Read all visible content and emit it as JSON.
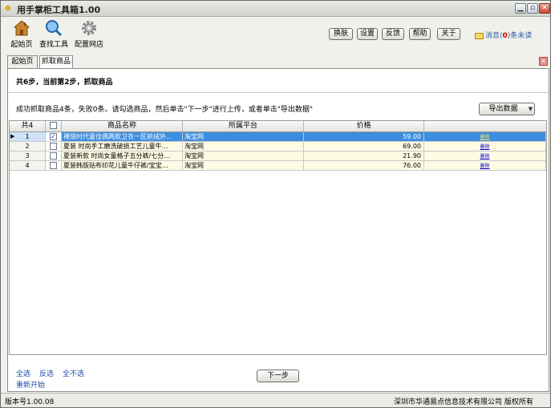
{
  "window": {
    "title": "用手掌柜工具箱1.00",
    "min": "▁",
    "max": "▫",
    "close": "✕"
  },
  "toolbar": {
    "tools": [
      {
        "label": "起始页",
        "icon": "home-icon"
      },
      {
        "label": "查找工具",
        "icon": "magnifier-icon"
      },
      {
        "label": "配置网店",
        "icon": "gear-icon"
      }
    ],
    "buttons": [
      "换肤",
      "设置",
      "反馈",
      "帮助",
      "关于"
    ],
    "message": {
      "prefix": "消息(",
      "count": "0",
      "suffix": ")条未读"
    }
  },
  "tabs": [
    {
      "label": "起始页",
      "active": false
    },
    {
      "label": "抓取商品",
      "active": true
    }
  ],
  "panel": {
    "step": "共6步，当前第2步，抓取商品",
    "info": "成功抓取商品4条，失败0条。请勾选商品，然后单击\"下一步\"进行上传，或者单击\"导出数据\"",
    "export_label": "导出数据",
    "export_arrow": "▼"
  },
  "grid": {
    "headers": {
      "count": "共4",
      "name": "商品名称",
      "platform": "所属平台",
      "price": "价格"
    },
    "rows": [
      {
        "index": "1",
        "checked": "✓",
        "name": "裸馈时代童佳偶两款卫衣一区抓绒外…",
        "platform": "淘宝网",
        "price": "59.00",
        "action": "删除"
      },
      {
        "index": "2",
        "checked": "",
        "name": "夏装 时尚手工磨洗破损工艺儿童牛…",
        "platform": "淘宝网",
        "price": "69.00",
        "action": "删除"
      },
      {
        "index": "3",
        "checked": "",
        "name": "夏装新款 时尚女童格子五分裤/七分…",
        "platform": "淘宝网",
        "price": "21.90",
        "action": "删除"
      },
      {
        "index": "4",
        "checked": "",
        "name": "夏装韩版贴布印花儿童牛仔裤/宝宝…",
        "platform": "淘宝网",
        "price": "76.00",
        "action": "删除"
      }
    ]
  },
  "footer": {
    "select_all": "全选",
    "invert": "反选",
    "select_none": "全不选",
    "restart": "重新开始",
    "next": "下一步"
  },
  "status": {
    "version": "版本号1.00.08",
    "copyright": "深圳市华通易点信息技术有限公司 版权所有"
  },
  "colors": {
    "selected_row": "#3c8ddf",
    "row_bg": "#fdfbe4",
    "link": "#1c4fa8",
    "alert": "#d00000"
  }
}
